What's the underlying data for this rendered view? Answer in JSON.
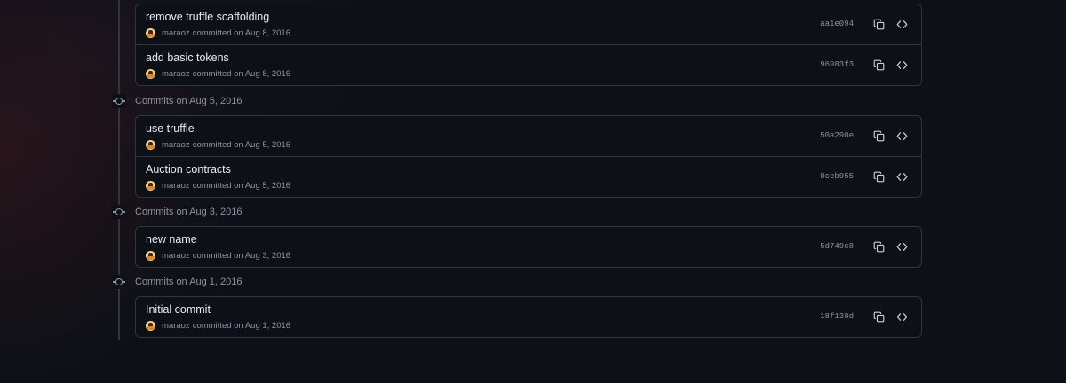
{
  "groups": [
    {
      "header": "",
      "commits": [
        {
          "title": "remove truffle scaffolding",
          "author": "maraoz",
          "meta": "committed on Aug 8, 2016",
          "sha": "aa1e094"
        },
        {
          "title": "add basic tokens",
          "author": "maraoz",
          "meta": "committed on Aug 8, 2016",
          "sha": "96983f3"
        }
      ]
    },
    {
      "header": "Commits on Aug 5, 2016",
      "commits": [
        {
          "title": "use truffle",
          "author": "maraoz",
          "meta": "committed on Aug 5, 2016",
          "sha": "50a290e"
        },
        {
          "title": "Auction contracts",
          "author": "maraoz",
          "meta": "committed on Aug 5, 2016",
          "sha": "0ceb955"
        }
      ]
    },
    {
      "header": "Commits on Aug 3, 2016",
      "commits": [
        {
          "title": "new name",
          "author": "maraoz",
          "meta": "committed on Aug 3, 2016",
          "sha": "5d749c8"
        }
      ]
    },
    {
      "header": "Commits on Aug 1, 2016",
      "commits": [
        {
          "title": "Initial commit",
          "author": "maraoz",
          "meta": "committed on Aug 1, 2016",
          "sha": "18f138d"
        }
      ]
    }
  ],
  "icons": {
    "copy": "copy-icon",
    "browse": "code-icon",
    "timeline": "git-commit-icon"
  },
  "colors": {
    "background": "#0d1117",
    "border": "#30363d",
    "text": "#e6edf3",
    "muted": "#8b949e"
  }
}
